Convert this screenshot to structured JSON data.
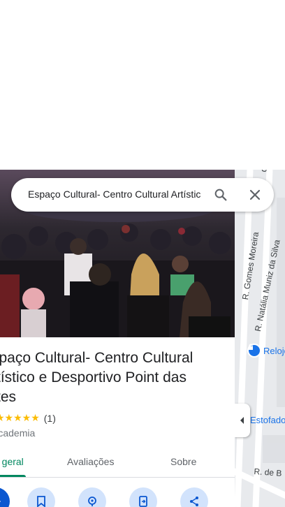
{
  "search": {
    "query": "Espaço Cultural- Centro Cultural Artístico e Desportivo Point das Artes"
  },
  "place": {
    "title": "Espaço Cultural- Centro Cultural Artístico e Desportivo Point das Artes",
    "rating_stars": "★★★★★",
    "review_count": "(1)",
    "category": "Academia"
  },
  "tabs": [
    {
      "label": "Visão geral"
    },
    {
      "label": "Avaliações"
    },
    {
      "label": "Sobre"
    }
  ],
  "map": {
    "streets": [
      {
        "label": "R. Gomes Moreira"
      },
      {
        "label": "R. Natália Muniz da Silva"
      },
      {
        "label": "R. de B"
      }
    ],
    "pois": [
      {
        "label": "Relojoaria"
      },
      {
        "label": "Estofados"
      }
    ]
  },
  "colors": {
    "accent_green": "#01875f",
    "action_blue": "#0b57d0",
    "action_tint": "#d2e3fc",
    "star": "#fbbc04"
  }
}
